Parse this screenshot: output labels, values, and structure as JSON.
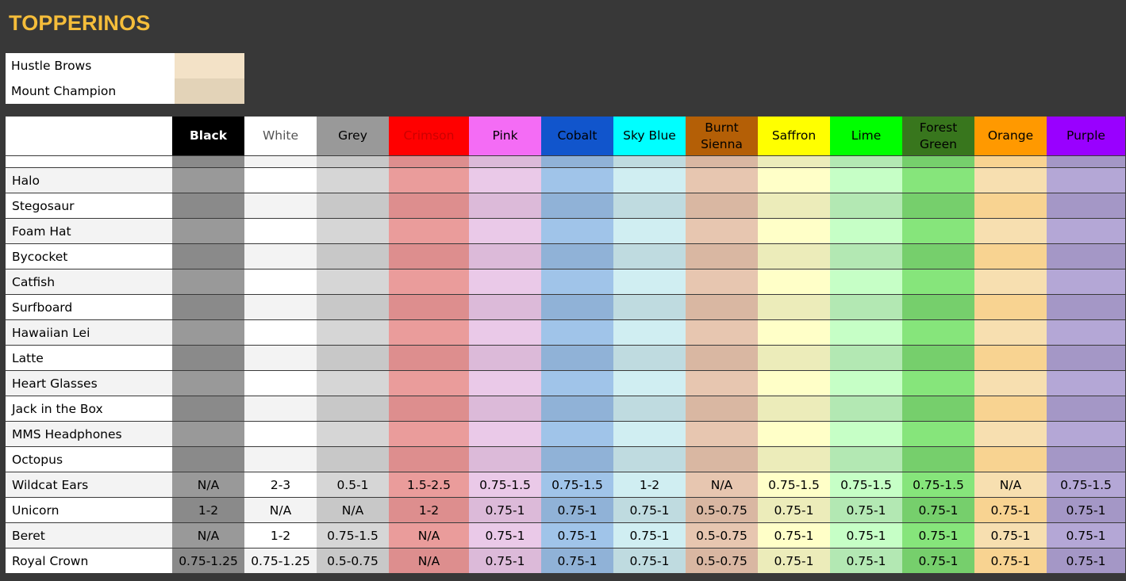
{
  "title": "TOPPERINOS",
  "legend": [
    {
      "label": "Hustle Brows",
      "color": "#f3e2c7"
    },
    {
      "label": "Mount Champion",
      "color": "#e3d3b8"
    }
  ],
  "columns": [
    {
      "label": "Black",
      "head_bg": "#000000",
      "head_fg": "#ffffff",
      "bold": true,
      "cells": [
        "#999999",
        "#8a8a8a"
      ]
    },
    {
      "label": "White",
      "head_bg": "#ffffff",
      "head_fg": "#555555",
      "bold": false,
      "cells": [
        "#ffffff",
        "#f3f3f3"
      ]
    },
    {
      "label": "Grey",
      "head_bg": "#999999",
      "head_fg": "#000000",
      "bold": false,
      "cells": [
        "#d6d6d6",
        "#c8c8c8"
      ]
    },
    {
      "label": "Crimson",
      "head_bg": "#ff0000",
      "head_fg": "#cc0000",
      "bold": false,
      "cells": [
        "#ea9c9b",
        "#dd8e8e"
      ]
    },
    {
      "label": "Pink",
      "head_bg": "#f46cf5",
      "head_fg": "#000000",
      "bold": false,
      "cells": [
        "#eac9e8",
        "#dcbad9"
      ]
    },
    {
      "label": "Cobalt",
      "head_bg": "#1155cc",
      "head_fg": "#000000",
      "bold": false,
      "cells": [
        "#a0c4e9",
        "#90b2d7"
      ]
    },
    {
      "label": "Sky Blue",
      "head_bg": "#00ffff",
      "head_fg": "#000000",
      "bold": false,
      "cells": [
        "#d0eef2",
        "#bfdbe0"
      ]
    },
    {
      "label": "Burnt Sienna",
      "head_bg": "#b45f06",
      "head_fg": "#000000",
      "bold": false,
      "cells": [
        "#e7c6b0",
        "#d9b7a2"
      ]
    },
    {
      "label": "Saffron",
      "head_bg": "#ffff00",
      "head_fg": "#000000",
      "bold": false,
      "cells": [
        "#ffffc8",
        "#ececba"
      ]
    },
    {
      "label": "Lime",
      "head_bg": "#00ff00",
      "head_fg": "#000000",
      "bold": false,
      "cells": [
        "#c6ffc6",
        "#b3e8b3"
      ]
    },
    {
      "label": "Forest Green",
      "head_bg": "#38761d",
      "head_fg": "#000000",
      "bold": false,
      "cells": [
        "#86e57b",
        "#76cf6c"
      ]
    },
    {
      "label": "Orange",
      "head_bg": "#ff9900",
      "head_fg": "#000000",
      "bold": false,
      "cells": [
        "#f7dfb0",
        "#f8d391"
      ]
    },
    {
      "label": "Purple",
      "head_bg": "#9900ff",
      "head_fg": "#000000",
      "bold": false,
      "cells": [
        "#b4a7d6",
        "#a497c6"
      ]
    }
  ],
  "name_cell_colors": [
    "#f3f3f3",
    "#ffffff"
  ],
  "rows": [
    {
      "name": "Halo",
      "values": []
    },
    {
      "name": "Stegosaur",
      "values": []
    },
    {
      "name": "Foam Hat",
      "values": []
    },
    {
      "name": "Bycocket",
      "values": []
    },
    {
      "name": "Catfish",
      "values": []
    },
    {
      "name": "Surfboard",
      "values": []
    },
    {
      "name": "Hawaiian Lei",
      "values": []
    },
    {
      "name": "Latte",
      "values": []
    },
    {
      "name": "Heart Glasses",
      "values": []
    },
    {
      "name": "Jack in the Box",
      "values": []
    },
    {
      "name": "MMS Headphones",
      "values": []
    },
    {
      "name": "Octopus",
      "values": []
    },
    {
      "name": "Wildcat Ears",
      "values": [
        "N/A",
        "2-3",
        "0.5-1",
        "1.5-2.5",
        "0.75-1.5",
        "0.75-1.5",
        "1-2",
        "N/A",
        "0.75-1.5",
        "0.75-1.5",
        "0.75-1.5",
        "N/A",
        "0.75-1.5"
      ]
    },
    {
      "name": "Unicorn",
      "values": [
        "1-2",
        "N/A",
        "N/A",
        "1-2",
        "0.75-1",
        "0.75-1",
        "0.75-1",
        "0.5-0.75",
        "0.75-1",
        "0.75-1",
        "0.75-1",
        "0.75-1",
        "0.75-1"
      ]
    },
    {
      "name": "Beret",
      "values": [
        "N/A",
        "1-2",
        "0.75-1.5",
        "N/A",
        "0.75-1",
        "0.75-1",
        "0.75-1",
        "0.5-0.75",
        "0.75-1",
        "0.75-1",
        "0.75-1",
        "0.75-1",
        "0.75-1"
      ]
    },
    {
      "name": "Royal Crown",
      "values": [
        "0.75-1.25",
        "0.75-1.25",
        "0.5-0.75",
        "N/A",
        "0.75-1",
        "0.75-1",
        "0.75-1",
        "0.5-0.75",
        "0.75-1",
        "0.75-1",
        "0.75-1",
        "0.75-1",
        "0.75-1"
      ]
    }
  ]
}
